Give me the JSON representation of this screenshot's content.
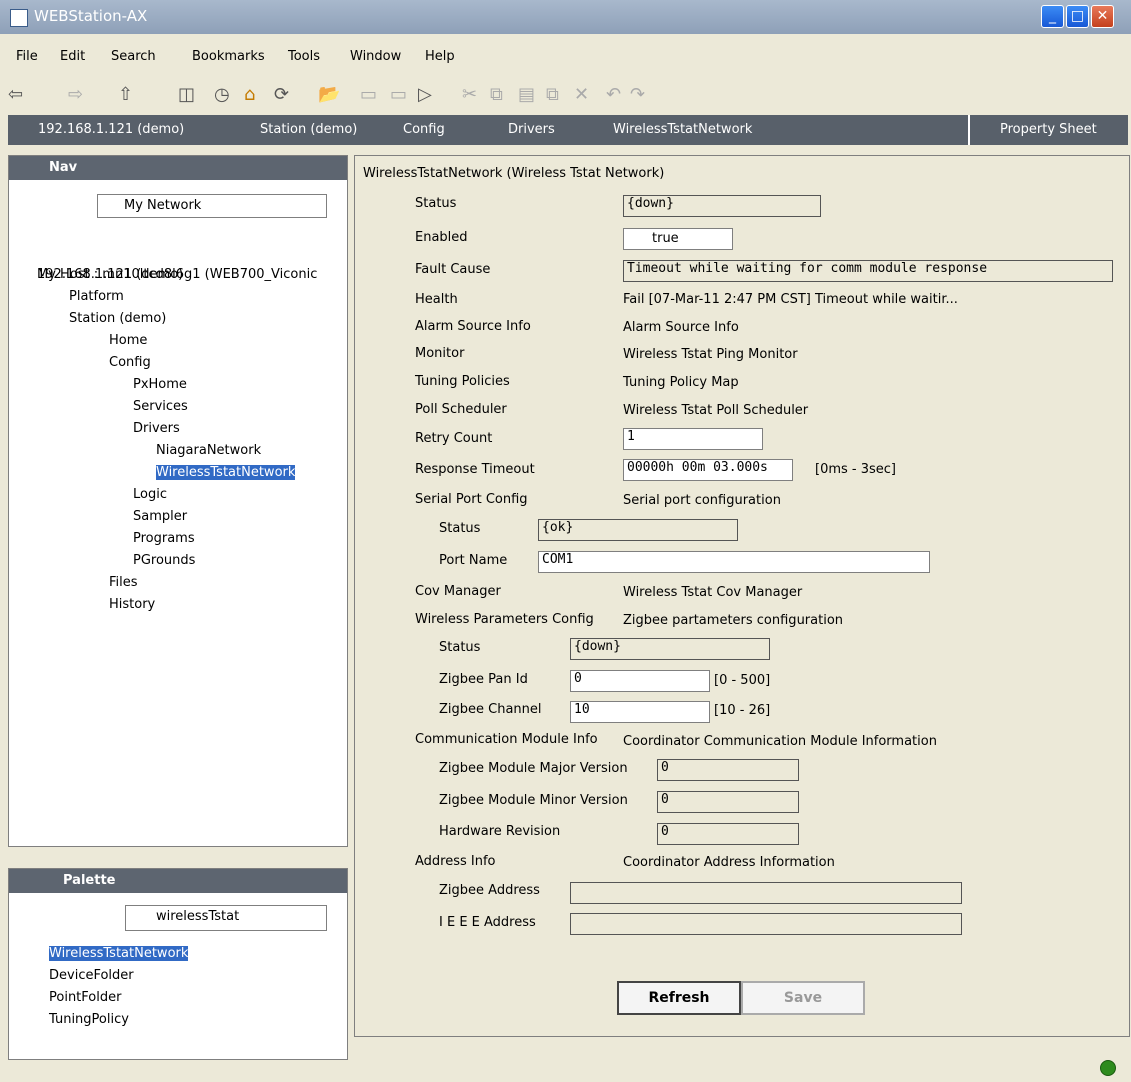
{
  "window": {
    "title": "WEBStation-AX"
  },
  "menu": [
    "File",
    "Edit",
    "Search",
    "Bookmarks",
    "Tools",
    "Window",
    "Help"
  ],
  "pathbar": {
    "items": [
      "192.168.1.121 (demo)",
      "Station (demo)",
      "Config",
      "Drivers",
      "WirelessTstatNetwork"
    ],
    "view": "Property Sheet"
  },
  "nav": {
    "title": "Nav",
    "network": "My Network",
    "tree": [
      {
        "label": "My Host : mn10ltcd8l6g1 (WEB700_Viconic",
        "level": 0
      },
      {
        "label": "192.168.1.121 (demo)",
        "level": 0
      },
      {
        "label": "Platform",
        "level": 1
      },
      {
        "label": "Station (demo)",
        "level": 1
      },
      {
        "label": "Home",
        "level": 2
      },
      {
        "label": "Config",
        "level": 2
      },
      {
        "label": "PxHome",
        "level": 3
      },
      {
        "label": "Services",
        "level": 3
      },
      {
        "label": "Drivers",
        "level": 3
      },
      {
        "label": "NiagaraNetwork",
        "level": 4
      },
      {
        "label": "WirelessTstatNetwork",
        "level": 4
      },
      {
        "label": "Logic",
        "level": 3
      },
      {
        "label": "Sampler",
        "level": 3
      },
      {
        "label": "Programs",
        "level": 3
      },
      {
        "label": "PGrounds",
        "level": 3
      },
      {
        "label": "Files",
        "level": 2
      },
      {
        "label": "History",
        "level": 2
      }
    ],
    "scroll_mark": "III"
  },
  "palette": {
    "title": "Palette",
    "selected": "wirelessTstat",
    "tree": [
      "WirelessTstatNetwork",
      "DeviceFolder",
      "PointFolder",
      "TuningPolicy"
    ]
  },
  "sheet": {
    "header": "WirelessTstatNetwork  (Wireless Tstat Network)",
    "status_label": "Status",
    "status_value": "{down}",
    "enabled_label": "Enabled",
    "enabled_value": "true",
    "fault_label": "Fault Cause",
    "fault_value": "Timeout while waiting for comm module response",
    "health_label": "Health",
    "health_value": "Fail [07-Mar-11 2:47 PM CST] Timeout while waitir...",
    "alarm_label": "Alarm Source Info",
    "alarm_value": "Alarm Source Info",
    "monitor_label": "Monitor",
    "monitor_value": "Wireless Tstat Ping Monitor",
    "tuning_label": "Tuning Policies",
    "tuning_value": "Tuning Policy Map",
    "poll_label": "Poll Scheduler",
    "poll_value": "Wireless Tstat Poll Scheduler",
    "retry_label": "Retry Count",
    "retry_value": "1",
    "resp_label": "Response Timeout",
    "resp_value": "00000h 00m 03.000s",
    "resp_range": "[0ms - 3sec]",
    "serial_label": "Serial Port Config",
    "serial_value": "Serial port configuration",
    "serial_status_label": "Status",
    "serial_status_value": "{ok}",
    "port_label": "Port Name",
    "port_value": "COM1",
    "cov_label": "Cov Manager",
    "cov_value": "Wireless Tstat Cov Manager",
    "wpc_label": "Wireless Parameters Config",
    "wpc_value": "Zigbee partameters configuration",
    "wpc_status_label": "Status",
    "wpc_status_value": "{down}",
    "pan_label": "Zigbee Pan Id",
    "pan_value": "0",
    "pan_range": "[0 - 500]",
    "chan_label": "Zigbee Channel",
    "chan_value": "10",
    "chan_range": "[10 - 26]",
    "cmi_label": "Communication Module Info",
    "cmi_value": "Coordinator Communication Module Information",
    "major_label": "Zigbee Module Major Version",
    "major_value": "0",
    "minor_label": "Zigbee Module Minor Version",
    "minor_value": "0",
    "hw_label": "Hardware Revision",
    "hw_value": "0",
    "addr_label": "Address Info",
    "addr_value": "Coordinator Address Information",
    "zaddr_label": "Zigbee Address",
    "zaddr_value": "",
    "ieee_label": "I E E E Address",
    "ieee_value": ""
  },
  "buttons": {
    "refresh": "Refresh",
    "save": "Save"
  },
  "colors": {
    "titlebar": "#8ea0b8",
    "selection": "#316ac5",
    "panel_header": "#5d6570"
  }
}
